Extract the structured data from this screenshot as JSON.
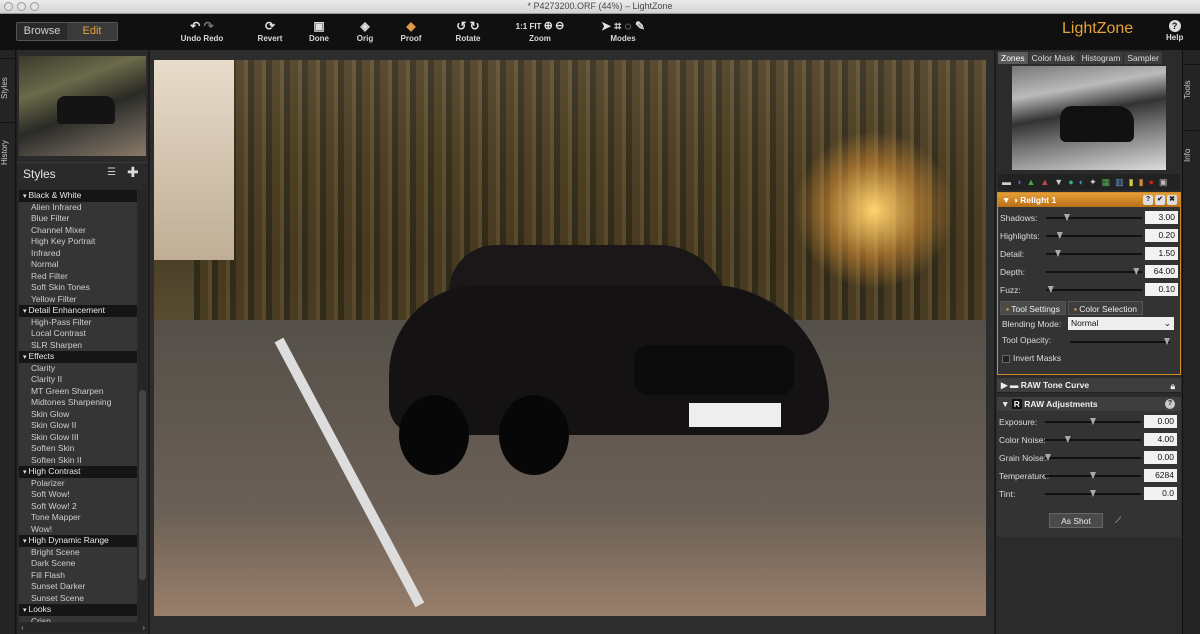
{
  "window": {
    "title": "* P4273200.ORF (44%) – LightZone"
  },
  "mode": {
    "browse": "Browse",
    "edit": "Edit"
  },
  "toolbar": {
    "undo_redo": "Undo Redo",
    "revert": "Revert",
    "done": "Done",
    "orig": "Orig",
    "proof": "Proof",
    "rotate": "Rotate",
    "zoom": "Zoom",
    "zoom_1to1": "1:1",
    "zoom_fit": "FIT",
    "modes": "Modes",
    "brand": "LightZone",
    "help": "Help"
  },
  "left_tabs": {
    "styles": "Styles",
    "history": "History"
  },
  "styles": {
    "title": "Styles",
    "categories": [
      {
        "name": "Black & White",
        "items": [
          "Alien Infrared",
          "Blue Filter",
          "Channel Mixer",
          "High Key Portrait",
          "Infrared",
          "Normal",
          "Red Filter",
          "Soft Skin Tones",
          "Yellow Filter"
        ]
      },
      {
        "name": "Detail Enhancement",
        "items": [
          "High-Pass Filter",
          "Local Contrast",
          "SLR Sharpen"
        ]
      },
      {
        "name": "Effects",
        "items": [
          "Clarity",
          "Clarity II",
          "MT Green Sharpen",
          "Midtones Sharpening",
          "Skin Glow",
          "Skin Glow II",
          "Skin Glow III",
          "Soften Skin",
          "Soften Skin II"
        ]
      },
      {
        "name": "High Contrast",
        "items": [
          "Polarizer",
          "Soft Wow!",
          "Soft Wow! 2",
          "Tone Mapper",
          "Wow!"
        ]
      },
      {
        "name": "High Dynamic Range",
        "items": [
          "Bright Scene",
          "Dark Scene",
          "Fill Flash",
          "Sunset Darker",
          "Sunset Scene"
        ]
      },
      {
        "name": "Looks",
        "items": [
          "Crisp"
        ]
      }
    ]
  },
  "right_tabs": {
    "tools": "Tools",
    "info": "Info"
  },
  "zone_tabs": [
    "Zones",
    "Color Mask",
    "Histogram",
    "Sampler"
  ],
  "relight": {
    "title": "Relight 1",
    "sliders": [
      {
        "label": "Shadows:",
        "value": "3.00",
        "pos": 0.2
      },
      {
        "label": "Highlights:",
        "value": "0.20",
        "pos": 0.12
      },
      {
        "label": "Detail:",
        "value": "1.50",
        "pos": 0.1
      },
      {
        "label": "Depth:",
        "value": "64.00",
        "pos": 0.97
      },
      {
        "label": "Fuzz:",
        "value": "0.10",
        "pos": 0.02
      }
    ],
    "tab_tool_settings": "Tool Settings",
    "tab_color_selection": "Color Selection",
    "blending_label": "Blending Mode:",
    "blending_value": "Normal",
    "opacity_label": "Tool Opacity:",
    "invert_label": "Invert Masks"
  },
  "tone_curve": {
    "title": "RAW Tone Curve"
  },
  "raw": {
    "title": "RAW Adjustments",
    "sliders": [
      {
        "label": "Exposure:",
        "value": "0.00",
        "pos": 0.5
      },
      {
        "label": "Color Noise:",
        "value": "4.00",
        "pos": 0.22
      },
      {
        "label": "Grain Noise:",
        "value": "0.00",
        "pos": 0.0
      },
      {
        "label": "Temperature:",
        "value": "6284",
        "pos": 0.5
      },
      {
        "label": "Tint:",
        "value": "0.0",
        "pos": 0.5
      }
    ],
    "as_shot": "As Shot"
  }
}
